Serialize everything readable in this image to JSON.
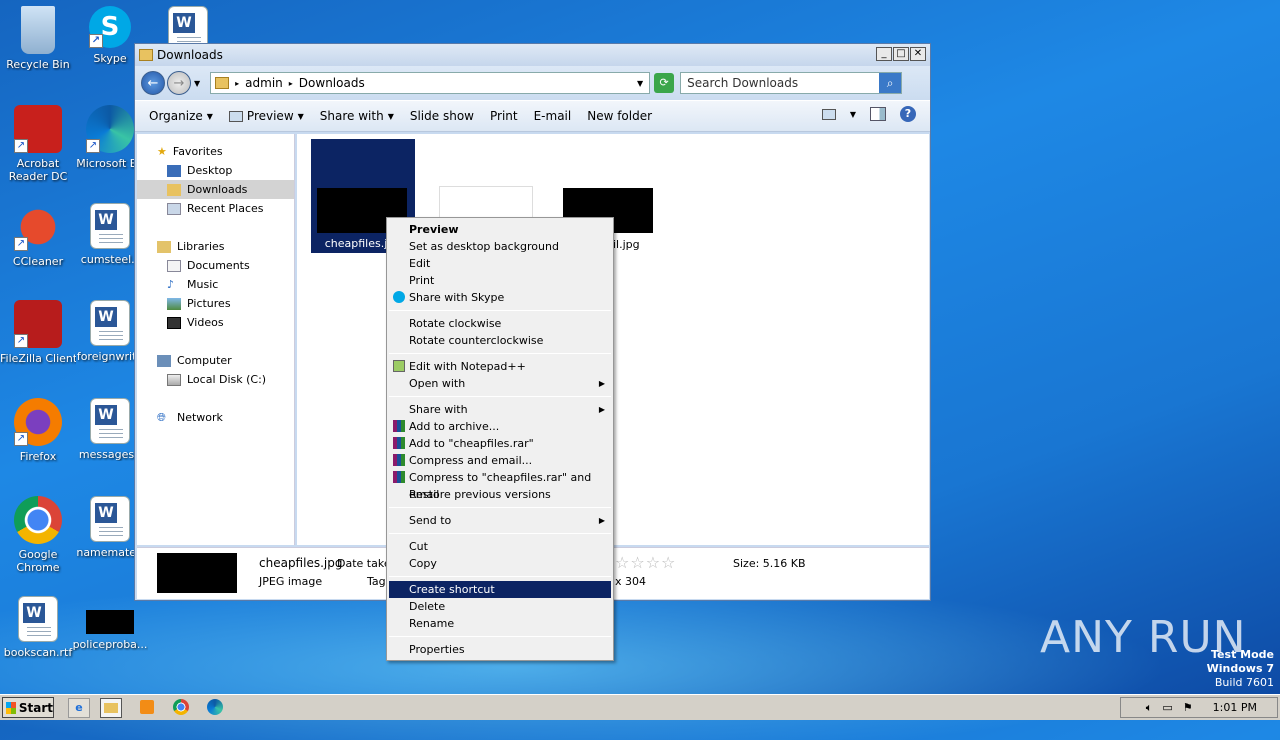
{
  "desktop": {
    "icons": [
      {
        "label": "Recycle Bin"
      },
      {
        "label": "Skype"
      },
      {
        "label": "Acrobat Reader DC"
      },
      {
        "label": "Microsoft Ed"
      },
      {
        "label": "CCleaner"
      },
      {
        "label": "cumsteel.r"
      },
      {
        "label": "FileZilla Client"
      },
      {
        "label": "foreignwrite"
      },
      {
        "label": "Firefox"
      },
      {
        "label": "messagesd"
      },
      {
        "label": "Google Chrome"
      },
      {
        "label": "namemateri"
      },
      {
        "label": "bookscan.rtf"
      },
      {
        "label": "policeproba..."
      }
    ]
  },
  "window": {
    "title": "Downloads",
    "address": {
      "part1": "admin",
      "part2": "Downloads"
    },
    "search_placeholder": "Search Downloads",
    "toolbar": [
      "Organize",
      "Preview",
      "Share with",
      "Slide show",
      "Print",
      "E-mail",
      "New folder"
    ],
    "nav": {
      "favorites": "Favorites",
      "desktop": "Desktop",
      "downloads": "Downloads",
      "recent": "Recent Places",
      "libraries": "Libraries",
      "documents": "Documents",
      "music": "Music",
      "pictures": "Pictures",
      "videos": "Videos",
      "computer": "Computer",
      "localdisk": "Local Disk (C:)",
      "network": "Network"
    },
    "files": [
      {
        "name": "cheapfiles.jpg"
      },
      {
        "name": ""
      },
      {
        "name": "uncil.jpg"
      }
    ],
    "details": {
      "filename": "cheapfiles.jpg",
      "date_label": "Date taker",
      "type": "JPEG image",
      "tags_label": "Tag",
      "dimensions": "x 304",
      "size": "Size: 5.16 KB"
    }
  },
  "context_menu": {
    "items": [
      "Preview",
      "Set as desktop background",
      "Edit",
      "Print",
      "Share with Skype",
      "Rotate clockwise",
      "Rotate counterclockwise",
      "Edit with Notepad++",
      "Open with",
      "Share with",
      "Add to archive...",
      "Add to \"cheapfiles.rar\"",
      "Compress and email...",
      "Compress to \"cheapfiles.rar\" and email",
      "Restore previous versions",
      "Send to",
      "Cut",
      "Copy",
      "Create shortcut",
      "Delete",
      "Rename",
      "Properties"
    ]
  },
  "taskbar": {
    "start": "Start",
    "clock": "1:01 PM"
  },
  "watermark": "ANY RUN",
  "testmode": {
    "line1": "Test Mode",
    "line2": "Windows 7",
    "line3": "Build 7601"
  }
}
